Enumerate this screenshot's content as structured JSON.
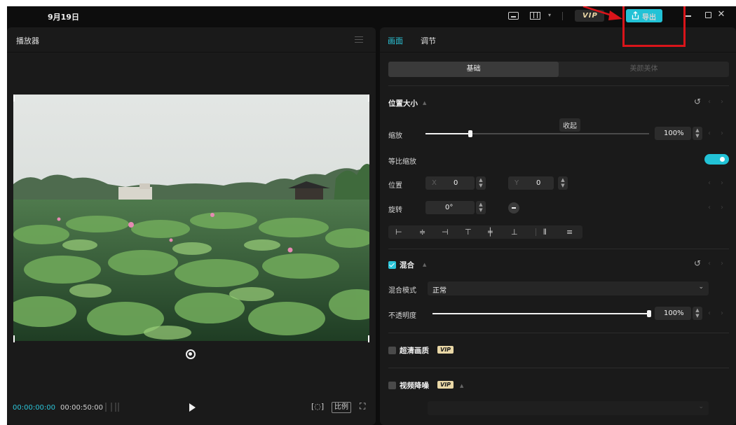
{
  "titlebar": {
    "title": "9月19日",
    "vip_label": "VIP",
    "export_label": "导出"
  },
  "player": {
    "title": "播放器",
    "current_time": "00:00:00:00",
    "duration": "00:00:50:00",
    "ratio_label": "比例"
  },
  "inspector": {
    "tabs": [
      {
        "label": "画面",
        "active": true
      },
      {
        "label": "调节",
        "active": false
      }
    ],
    "segments": [
      {
        "label": "基础",
        "active": true
      },
      {
        "label": "美颜美体",
        "active": false
      }
    ],
    "position_size": {
      "title": "位置大小",
      "scale_label": "缩放",
      "scale_value": "100%",
      "scale_fraction": 0.2,
      "tooltip": "收起",
      "uniform_scale_label": "等比缩放",
      "uniform_scale_on": true,
      "position_label": "位置",
      "x_axis": "X",
      "x_value": "0",
      "y_axis": "Y",
      "y_value": "0",
      "rotate_label": "旋转",
      "rotate_value": "0°"
    },
    "blend": {
      "title": "混合",
      "checked": true,
      "mode_label": "混合模式",
      "mode_value": "正常",
      "opacity_label": "不透明度",
      "opacity_value": "100%",
      "opacity_fraction": 1.0
    },
    "hd": {
      "title": "超清画质",
      "checked": false,
      "badge": "VIP"
    },
    "denoise": {
      "title": "视频降噪",
      "checked": false,
      "badge": "VIP"
    }
  },
  "colors": {
    "accent": "#22c2d6",
    "annotation": "#d9141a",
    "vip_gold": "#e9d7a6"
  }
}
